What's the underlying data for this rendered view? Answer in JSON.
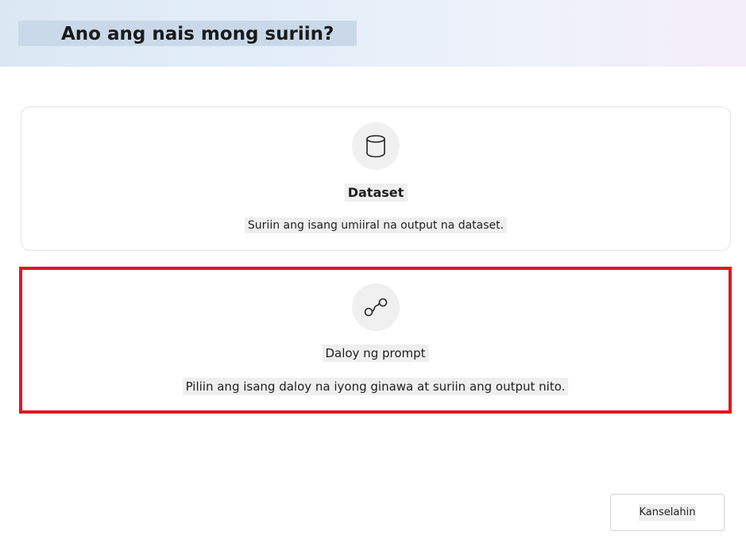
{
  "dialog": {
    "title": "Ano ang nais mong suriin?"
  },
  "options": [
    {
      "title": "Dataset",
      "description": "Suriin ang isang umiiral na output na dataset.",
      "icon": "database-icon",
      "highlighted": false
    },
    {
      "title": "Daloy ng prompt",
      "description": "Piliin ang isang daloy na iyong ginawa at suriin ang output nito.",
      "icon": "flow-icon",
      "highlighted": true
    }
  ],
  "footer": {
    "cancel_label": "Kanselahin"
  },
  "colors": {
    "highlight_border": "#e0171f",
    "header_gradient_start": "#dbe8f4",
    "header_gradient_end": "#f4eef8"
  }
}
